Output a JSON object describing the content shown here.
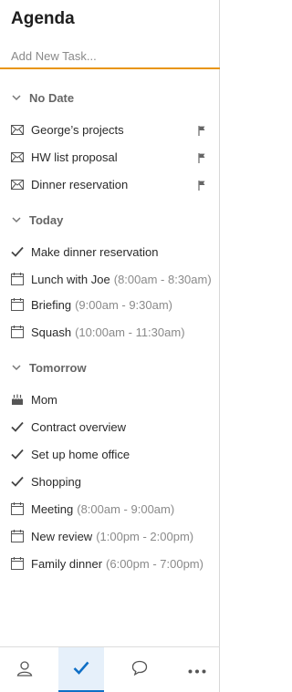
{
  "header": {
    "title": "Agenda"
  },
  "add_task": {
    "placeholder": "Add New Task..."
  },
  "sections": {
    "no_date": {
      "label": "No Date",
      "items": [
        {
          "label": "George’s projects",
          "icon": "envelope-icon"
        },
        {
          "label": "HW list proposal",
          "icon": "envelope-icon"
        },
        {
          "label": "Dinner reservation",
          "icon": "envelope-icon"
        }
      ]
    },
    "today": {
      "label": "Today",
      "items": [
        {
          "label": "Make dinner reservation",
          "time": "",
          "icon": "checkmark-icon"
        },
        {
          "label": "Lunch with Joe",
          "time": "(8:00am - 8:30am)",
          "icon": "calendar-icon"
        },
        {
          "label": "Briefing",
          "time": "(9:00am - 9:30am)",
          "icon": "calendar-icon"
        },
        {
          "label": "Squash",
          "time": "(10:00am - 11:30am)",
          "icon": "calendar-icon"
        }
      ]
    },
    "tomorrow": {
      "label": "Tomorrow",
      "items": [
        {
          "label": "Mom",
          "time": "",
          "icon": "birthday-cake-icon"
        },
        {
          "label": "Contract overview",
          "time": "",
          "icon": "checkmark-icon"
        },
        {
          "label": "Set up home office",
          "time": "",
          "icon": "checkmark-icon"
        },
        {
          "label": "Shopping",
          "time": "",
          "icon": "checkmark-icon"
        },
        {
          "label": "Meeting",
          "time": "(8:00am - 9:00am)",
          "icon": "calendar-icon"
        },
        {
          "label": "New review",
          "time": "(1:00pm - 2:00pm)",
          "icon": "calendar-icon"
        },
        {
          "label": "Family dinner",
          "time": "(6:00pm - 7:00pm)",
          "icon": "calendar-icon"
        }
      ]
    }
  },
  "bottom_tabs": [
    "person-icon",
    "checkmark-icon",
    "chat-bubble-icon",
    "more-icon"
  ],
  "colors": {
    "accent": "#e8950f",
    "active_tab": "#0f6fc6",
    "active_tab_bg": "#e6f0fa"
  }
}
